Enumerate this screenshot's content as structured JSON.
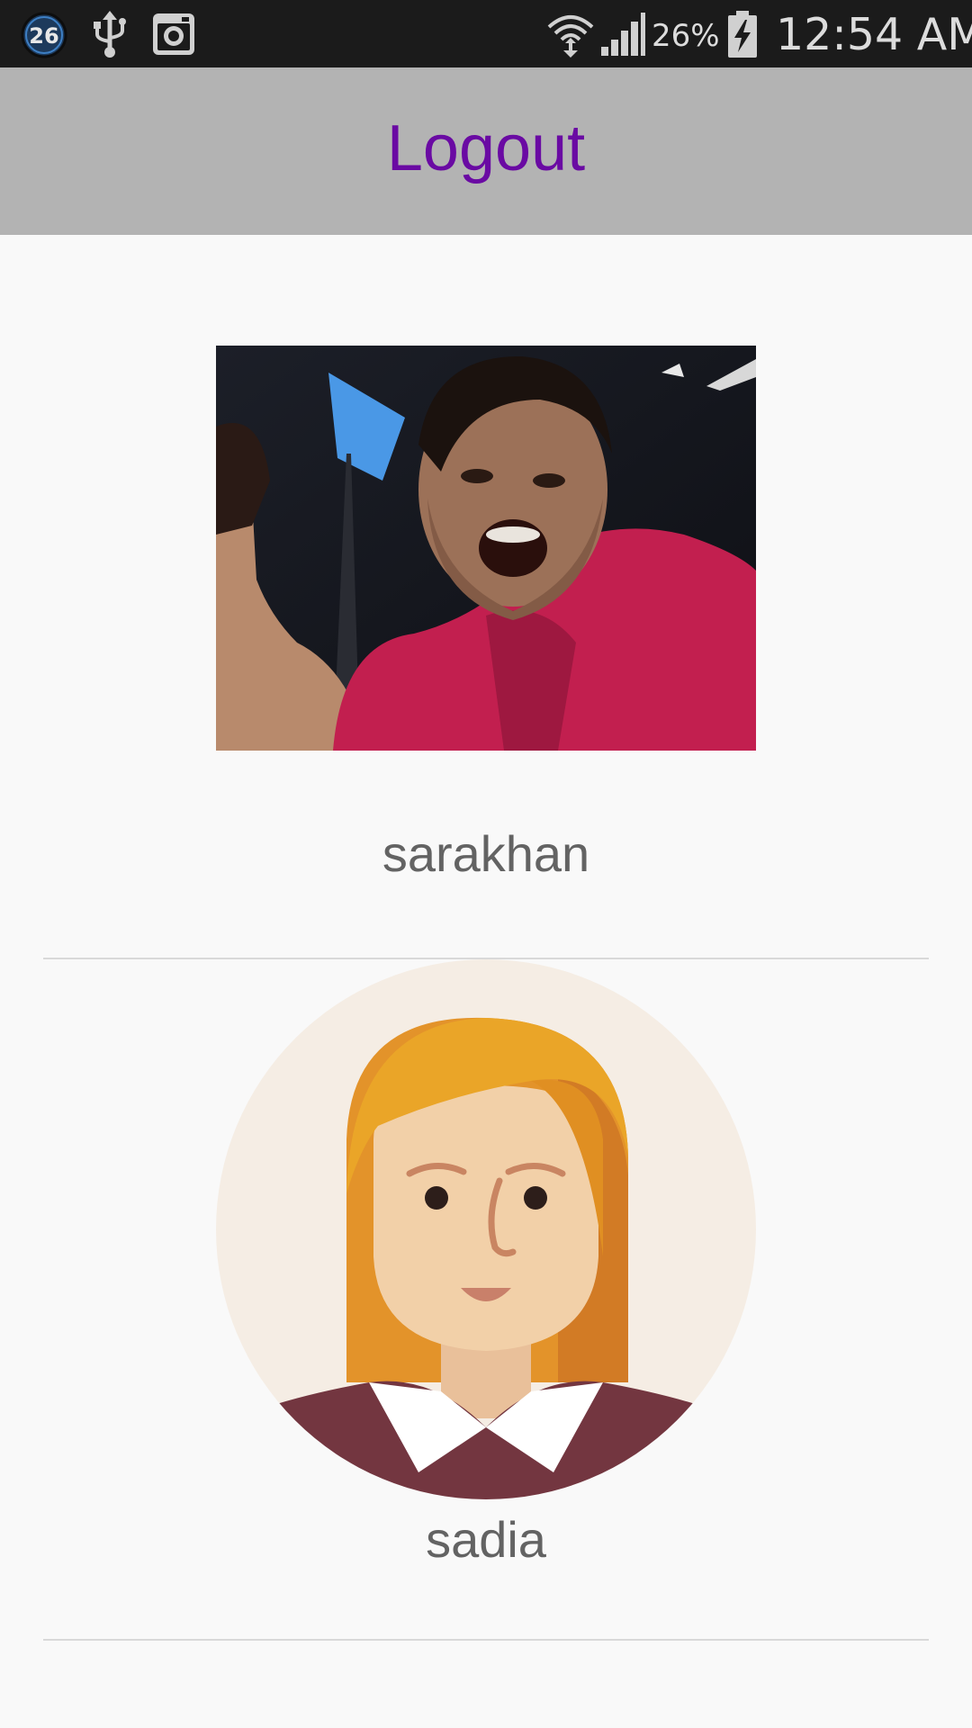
{
  "status_bar": {
    "notification_count": "26",
    "battery_percent": "26%",
    "time": "12:54 AM",
    "icons": [
      "notification-badge-icon",
      "usb-icon",
      "instagram-icon",
      "wifi-icon",
      "signal-icon",
      "battery-charging-icon"
    ]
  },
  "app_bar": {
    "logout_label": "Logout",
    "background_color": "#b3b3b3",
    "label_color": "#6a0aa3"
  },
  "users": [
    {
      "username": "sarakhan",
      "avatar": "profile-photo"
    },
    {
      "username": "sadia",
      "avatar": "default-female-avatar-icon"
    }
  ]
}
